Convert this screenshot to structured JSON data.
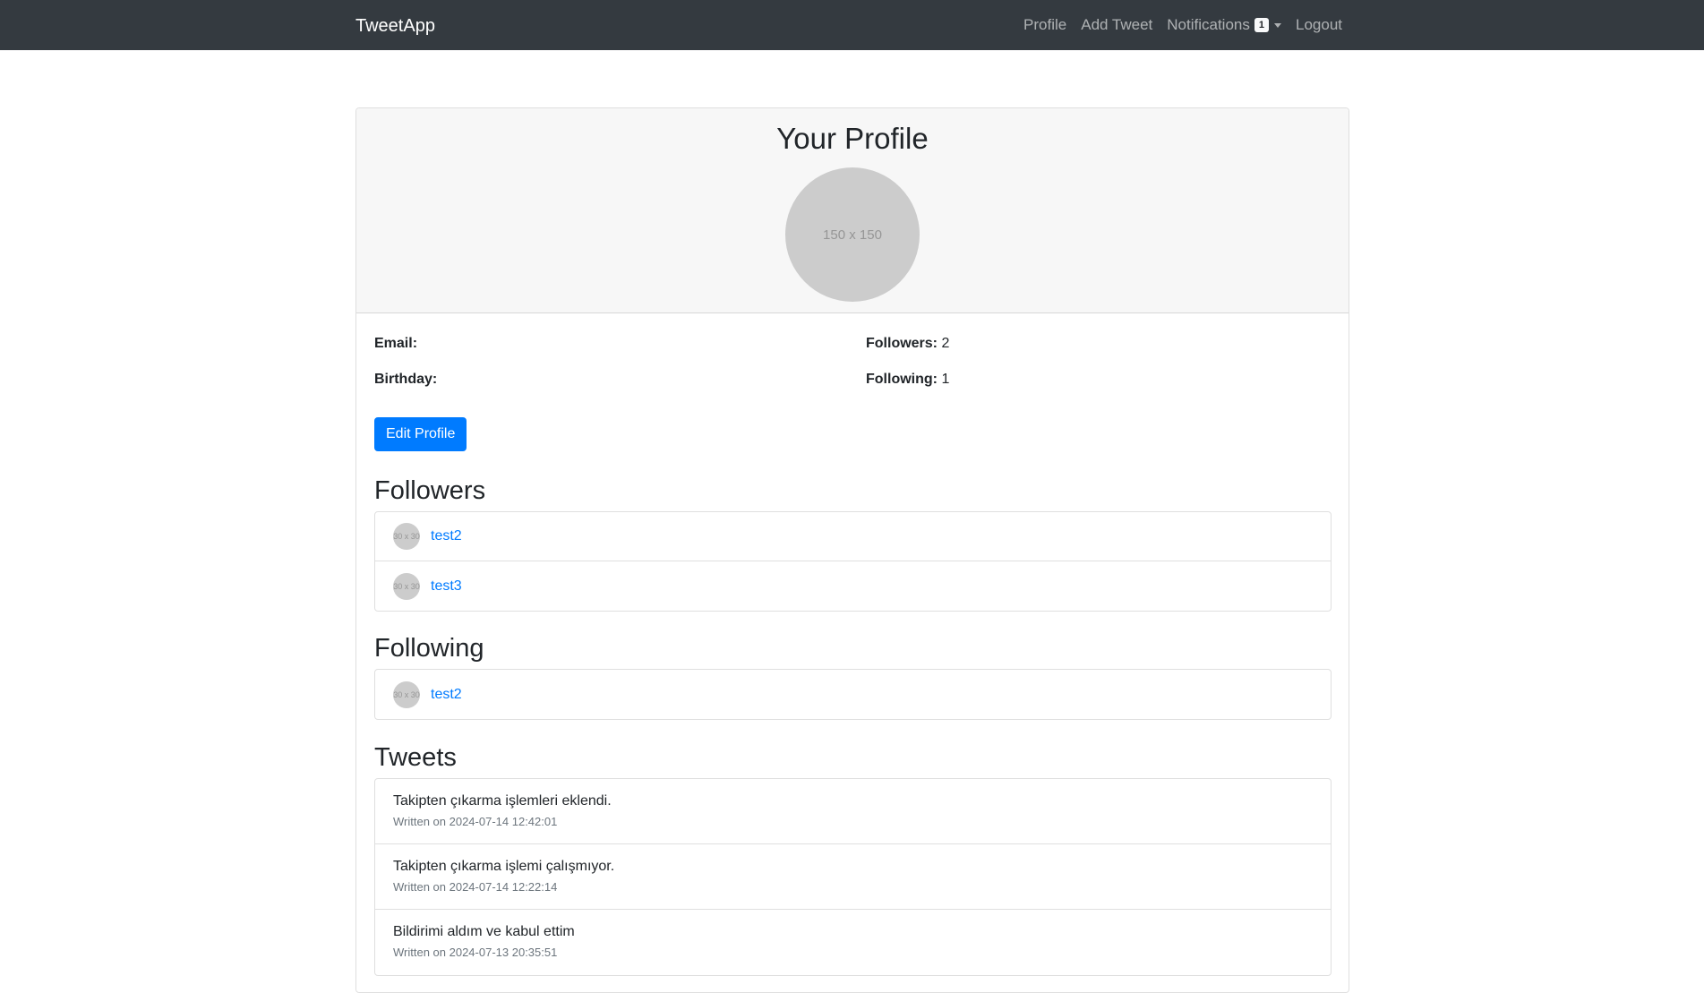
{
  "navbar": {
    "brand": "TweetApp",
    "links": {
      "profile": "Profile",
      "add_tweet": "Add Tweet",
      "notifications": "Notifications",
      "notifications_count": "1",
      "logout": "Logout"
    }
  },
  "profile": {
    "title": "Your Profile",
    "avatar_placeholder": "150 x 150",
    "email_label": "Email:",
    "email_value": "",
    "birthday_label": "Birthday:",
    "birthday_value": "",
    "followers_label": "Followers:",
    "followers_value": "2",
    "following_label": "Following:",
    "following_value": "1",
    "edit_button": "Edit Profile"
  },
  "followers": {
    "title": "Followers",
    "items": [
      {
        "avatar": "30 x 30",
        "name": "test2"
      },
      {
        "avatar": "30 x 30",
        "name": "test3"
      }
    ]
  },
  "following": {
    "title": "Following",
    "items": [
      {
        "avatar": "30 x 30",
        "name": "test2"
      }
    ]
  },
  "tweets": {
    "title": "Tweets",
    "items": [
      {
        "text": "Takipten çıkarma işlemleri eklendi.",
        "meta": "Written on 2024-07-14 12:42:01"
      },
      {
        "text": "Takipten çıkarma işlemi çalışmıyor.",
        "meta": "Written on 2024-07-14 12:22:14"
      },
      {
        "text": "Bildirimi aldım ve kabul ettim",
        "meta": "Written on 2024-07-13 20:35:51"
      }
    ]
  },
  "colors": {
    "navbar_bg": "#343a40",
    "primary": "#007bff",
    "card_header_bg": "#f7f7f7",
    "placeholder_gray": "#cccccc"
  }
}
